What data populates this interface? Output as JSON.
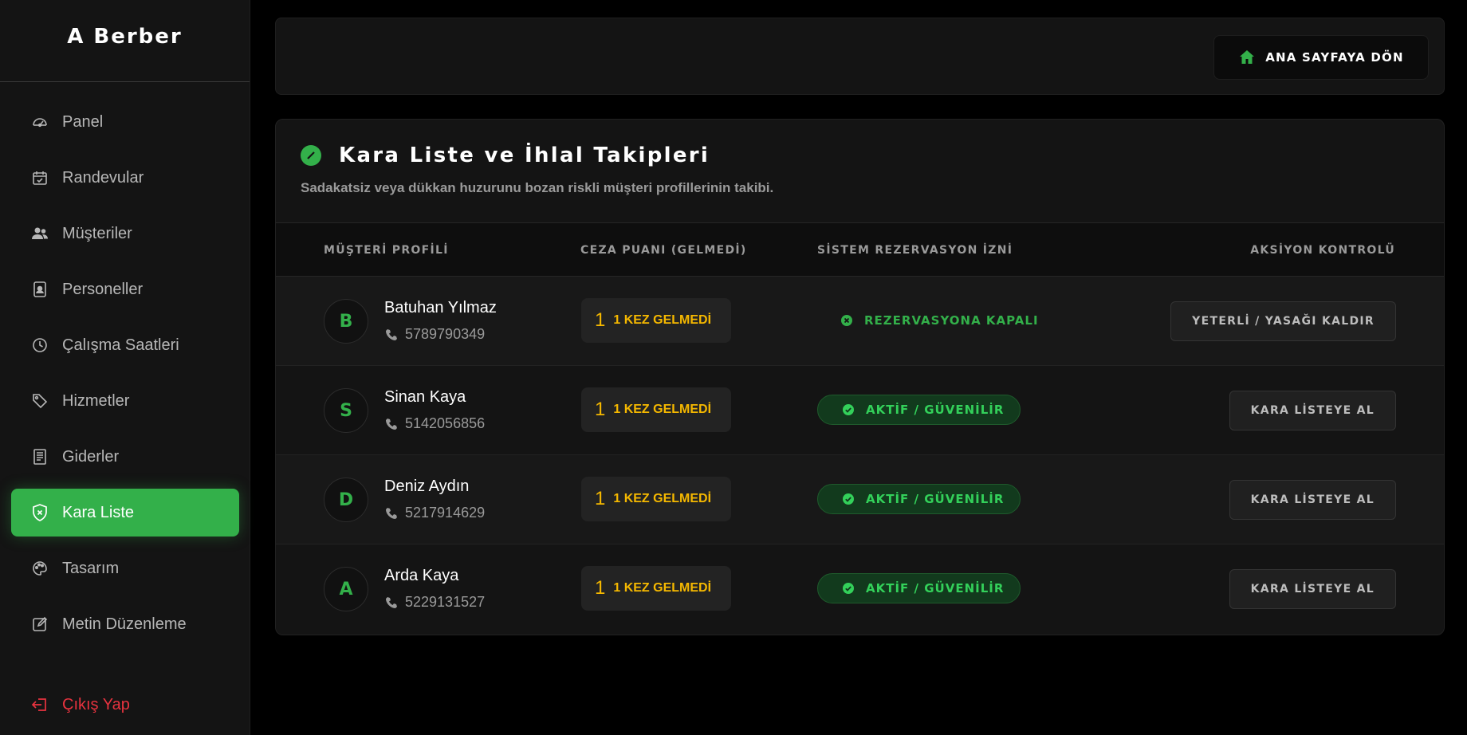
{
  "sidebar": {
    "brand": "A Berber",
    "items": [
      {
        "label": "Panel",
        "icon": "gauge-icon"
      },
      {
        "label": "Randevular",
        "icon": "calendar-icon"
      },
      {
        "label": "Müşteriler",
        "icon": "users-icon"
      },
      {
        "label": "Personeller",
        "icon": "id-badge-icon"
      },
      {
        "label": "Çalışma Saatleri",
        "icon": "clock-icon"
      },
      {
        "label": "Hizmetler",
        "icon": "tag-icon"
      },
      {
        "label": "Giderler",
        "icon": "receipt-icon"
      },
      {
        "label": "Kara Liste",
        "icon": "shield-icon",
        "active": true
      },
      {
        "label": "Tasarım",
        "icon": "palette-icon"
      },
      {
        "label": "Metin Düzenleme",
        "icon": "edit-icon"
      }
    ],
    "logout": "Çıkış Yap"
  },
  "topbar": {
    "home_button": "ANA SAYFAYA DÖN"
  },
  "card": {
    "title": "Kara Liste ve İhlal Takipleri",
    "subtitle": "Sadakatsiz veya dükkan huzurunu bozan riskli müşteri profillerinin takibi.",
    "columns": [
      "MÜŞTERİ PROFİLİ",
      "CEZA PUANI (GELMEDİ)",
      "SİSTEM REZERVASYON İZNİ",
      "AKSİYON KONTROLÜ"
    ],
    "rows": [
      {
        "initial": "B",
        "name": "Batuhan Yılmaz",
        "phone": "5789790349",
        "penalty_num": "1",
        "penalty_label": "1 KEZ GELMEDİ",
        "status": "REZERVASYONA KAPALI",
        "status_type": "closed",
        "action": "YETERLİ / YASAĞI KALDIR"
      },
      {
        "initial": "S",
        "name": "Sinan Kaya",
        "phone": "5142056856",
        "penalty_num": "1",
        "penalty_label": "1 KEZ GELMEDİ",
        "status": "AKTİF / GÜVENİLİR",
        "status_type": "active",
        "action": "KARA LİSTEYE AL"
      },
      {
        "initial": "D",
        "name": "Deniz Aydın",
        "phone": "5217914629",
        "penalty_num": "1",
        "penalty_label": "1 KEZ GELMEDİ",
        "status": "AKTİF / GÜVENİLİR",
        "status_type": "active",
        "action": "KARA LİSTEYE AL"
      },
      {
        "initial": "A",
        "name": "Arda Kaya",
        "phone": "5229131527",
        "penalty_num": "1",
        "penalty_label": "1 KEZ GELMEDİ",
        "status": "AKTİF / GÜVENİLİR",
        "status_type": "active",
        "action": "KARA LİSTEYE AL"
      }
    ]
  },
  "colors": {
    "accent": "#33b04a",
    "danger": "#e8333f",
    "warning": "#f5b800",
    "background": "#000000",
    "panel": "#141414"
  }
}
